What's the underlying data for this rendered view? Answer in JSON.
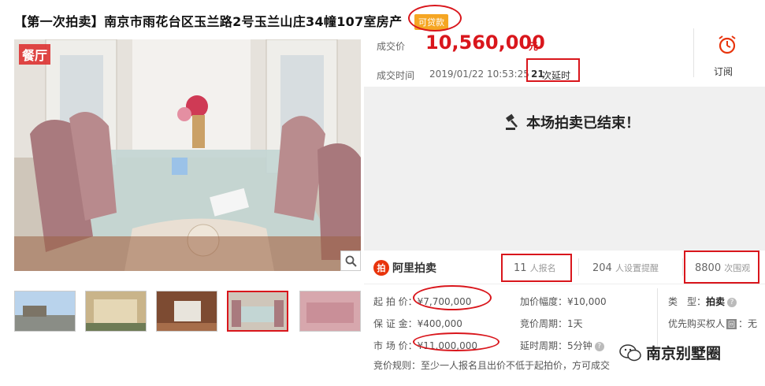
{
  "title": "【第一次拍卖】南京市雨花台区玉兰路2号玉兰山庄34幢107室房产",
  "loan_badge": "可贷款",
  "photo": {
    "label": "餐厅",
    "zoom_icon": "magnifier-icon"
  },
  "deal": {
    "price_label": "成交价",
    "price": "10,560,000",
    "price_unit": "元",
    "time_label": "成交时间",
    "time_value": "2019/01/22 10:53:25",
    "extensions_count": "21",
    "extensions_text": "次延时"
  },
  "subscribe": {
    "label": "订阅",
    "icon": "alarm-clock-icon"
  },
  "ended_message": "本场拍卖已结束！",
  "platform": "阿里拍卖",
  "stats": {
    "registered_count": "11",
    "registered_label": "人报名",
    "reminders_count": "204",
    "reminders_label": "人设置提醒",
    "views_count": "8800",
    "views_label": "次围观"
  },
  "details": {
    "start_price_label": "起 拍 价：",
    "start_price": "¥7,700,000",
    "increment_label": "加价幅度：",
    "increment": "¥10,000",
    "type_label": "类　型：",
    "type": "拍卖",
    "deposit_label": "保 证 金：",
    "deposit": "¥400,000",
    "cycle_label": "竞价周期：",
    "cycle": "1天",
    "priority_label": "优先购买权人",
    "priority_badge": "回",
    "priority_value": "：无",
    "market_label": "市 场 价：",
    "market_price": "¥11,000,000",
    "delay_label": "延时周期：",
    "delay": "5分钟",
    "rules_label": "竞价规则：",
    "rules": "至少一人报名且出价不低于起拍价，方可成交"
  },
  "watermark": "南京别墅圈",
  "colors": {
    "accent": "#d9161c",
    "badge": "#f5a623",
    "ended_bg": "#f0f0f0"
  }
}
